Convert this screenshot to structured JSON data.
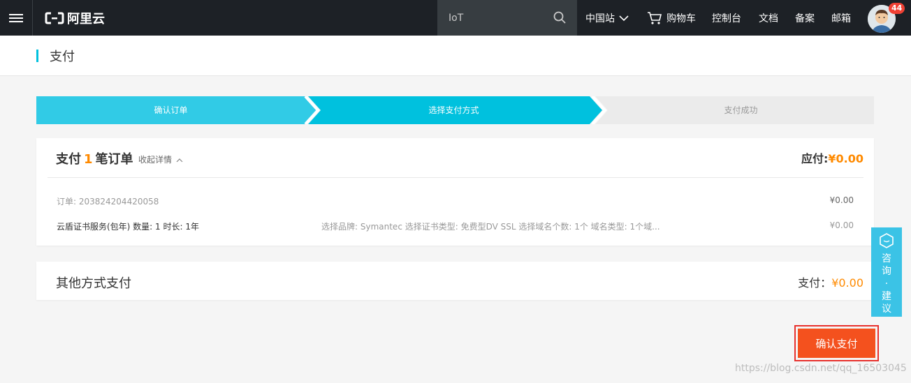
{
  "nav": {
    "logo_text": "阿里云",
    "search_value": "IoT",
    "items": [
      "中国站",
      "购物车",
      "控制台",
      "文档",
      "备案",
      "邮箱"
    ],
    "badge": "44"
  },
  "page": {
    "title": "支付"
  },
  "steps": [
    "确认订单",
    "选择支付方式",
    "支付成功"
  ],
  "order": {
    "title_prefix": "支付",
    "count": "1",
    "title_suffix": "笔订单",
    "collapse_label": "收起详情",
    "due_label": "应付:",
    "due_amount": "¥0.00",
    "order_id": "订单: 203824204420058",
    "order_amount": "¥0.00",
    "product": "云盾证书服务(包年) 数量: 1 时长: 1年",
    "specs": "选择品牌: Symantec 选择证书类型: 免费型DV SSL 选择域名个数: 1个 域名类型: 1个域...",
    "product_amount": "¥0.00"
  },
  "other": {
    "title": "其他方式支付",
    "pay_label": "支付：",
    "pay_amount": "¥0.00"
  },
  "confirm_label": "确认支付",
  "consult_label": "咨询·建议",
  "watermark": "https://blog.csdn.net/qq_16503045",
  "colors": {
    "accent": "#00c1de",
    "orange": "#ff8a00",
    "confirm": "#f4511e",
    "topbar": "#1d2126"
  }
}
